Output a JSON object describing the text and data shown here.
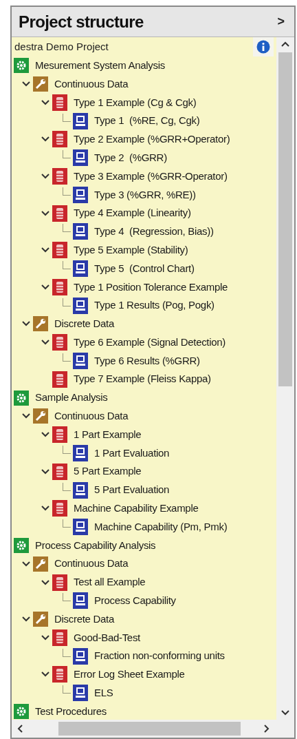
{
  "panel": {
    "title": "Project structure",
    "collapse_glyph": ">"
  },
  "tree": {
    "root": "destra Demo Project",
    "items": [
      {
        "kind": "group",
        "label": "Mesurement System Analysis",
        "children": [
          {
            "kind": "category",
            "label": "Continuous Data",
            "expanded": true,
            "children": [
              {
                "kind": "example",
                "label": "Type 1 Example (Cg & Cgk)",
                "expanded": true,
                "children": [
                  {
                    "kind": "result",
                    "label": "Type 1  (%RE, Cg, Cgk)"
                  }
                ]
              },
              {
                "kind": "example",
                "label": "Type 2 Example (%GRR+Operator)",
                "expanded": true,
                "children": [
                  {
                    "kind": "result",
                    "label": "Type 2  (%GRR)"
                  }
                ]
              },
              {
                "kind": "example",
                "label": "Type 3 Example (%GRR-Operator)",
                "expanded": true,
                "children": [
                  {
                    "kind": "result",
                    "label": "Type 3 (%GRR, %RE))"
                  }
                ]
              },
              {
                "kind": "example",
                "label": "Type 4 Example (Linearity)",
                "expanded": true,
                "children": [
                  {
                    "kind": "result",
                    "label": "Type 4  (Regression, Bias))"
                  }
                ]
              },
              {
                "kind": "example",
                "label": "Type 5 Example (Stability)",
                "expanded": true,
                "children": [
                  {
                    "kind": "result",
                    "label": "Type 5  (Control Chart)"
                  }
                ]
              },
              {
                "kind": "example",
                "label": "Type 1 Position Tolerance Example",
                "expanded": true,
                "children": [
                  {
                    "kind": "result",
                    "label": "Type 1 Results (Pog, Pogk)"
                  }
                ]
              }
            ]
          },
          {
            "kind": "category",
            "label": "Discrete Data",
            "expanded": true,
            "children": [
              {
                "kind": "example",
                "label": "Type 6 Example (Signal Detection)",
                "expanded": true,
                "children": [
                  {
                    "kind": "result",
                    "label": "Type 6 Results (%GRR)"
                  }
                ]
              },
              {
                "kind": "example",
                "label": "Type 7 Example (Fleiss Kappa)"
              }
            ]
          }
        ]
      },
      {
        "kind": "group",
        "label": "Sample Analysis",
        "children": [
          {
            "kind": "category",
            "label": "Continuous Data",
            "expanded": true,
            "children": [
              {
                "kind": "example",
                "label": "1 Part Example",
                "expanded": true,
                "children": [
                  {
                    "kind": "result",
                    "label": "1 Part Evaluation"
                  }
                ]
              },
              {
                "kind": "example",
                "label": "5 Part Example",
                "expanded": true,
                "children": [
                  {
                    "kind": "result",
                    "label": "5 Part Evaluation"
                  }
                ]
              },
              {
                "kind": "example",
                "label": "Machine Capability Example",
                "expanded": true,
                "children": [
                  {
                    "kind": "result",
                    "label": "Machine Capability (Pm, Pmk)"
                  }
                ]
              }
            ]
          }
        ]
      },
      {
        "kind": "group",
        "label": "Process Capability Analysis",
        "children": [
          {
            "kind": "category",
            "label": "Continuous Data",
            "expanded": true,
            "children": [
              {
                "kind": "example",
                "label": "Test all Example",
                "expanded": true,
                "children": [
                  {
                    "kind": "result",
                    "label": "Process Capability"
                  }
                ]
              }
            ]
          },
          {
            "kind": "category",
            "label": "Discrete Data",
            "expanded": true,
            "children": [
              {
                "kind": "example",
                "label": "Good-Bad-Test",
                "expanded": true,
                "children": [
                  {
                    "kind": "result",
                    "label": "Fraction non-conforming units"
                  }
                ]
              },
              {
                "kind": "example",
                "label": "Error Log Sheet Example",
                "expanded": true,
                "children": [
                  {
                    "kind": "result",
                    "label": "ELS"
                  }
                ]
              }
            ]
          }
        ]
      },
      {
        "kind": "group",
        "label": "Test Procedures"
      }
    ]
  }
}
